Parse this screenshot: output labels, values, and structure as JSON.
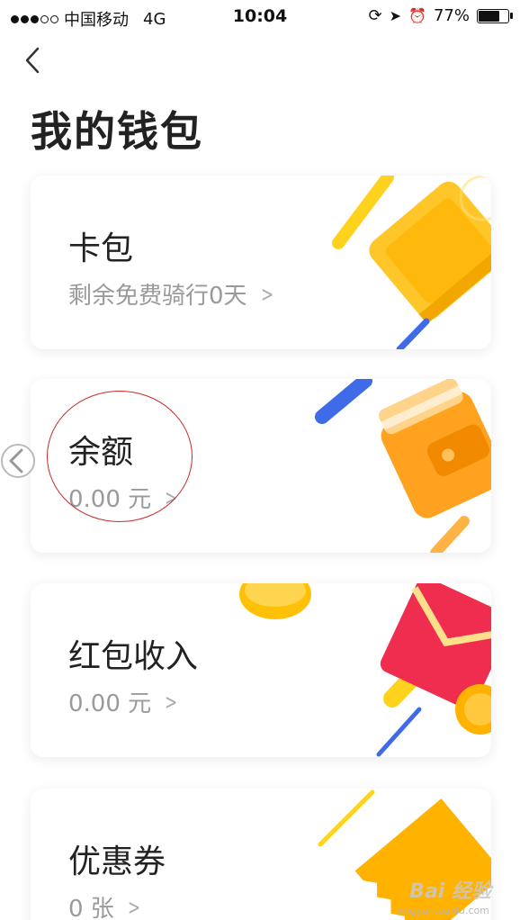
{
  "status_bar": {
    "carrier": "中国移动",
    "network": "4G",
    "time": "10:04",
    "battery": "77%",
    "battery_level": 0.77
  },
  "header": {
    "title": "我的钱包"
  },
  "cards": [
    {
      "title": "卡包",
      "subtitle": "剩余免费骑行0天"
    },
    {
      "title": "余额",
      "subtitle": "0.00 元"
    },
    {
      "title": "红包收入",
      "subtitle": "0.00 元"
    },
    {
      "title": "优惠券",
      "subtitle": "0 张"
    }
  ],
  "watermark": {
    "brand": "Bai 经验",
    "url": "jingyan.baidu.com"
  },
  "colors": {
    "accent_yellow": "#FFC107",
    "accent_orange": "#FFA21F",
    "accent_blue": "#3F6BE8",
    "accent_red": "#EE2D4F",
    "annotation_red": "#C92A2A"
  }
}
